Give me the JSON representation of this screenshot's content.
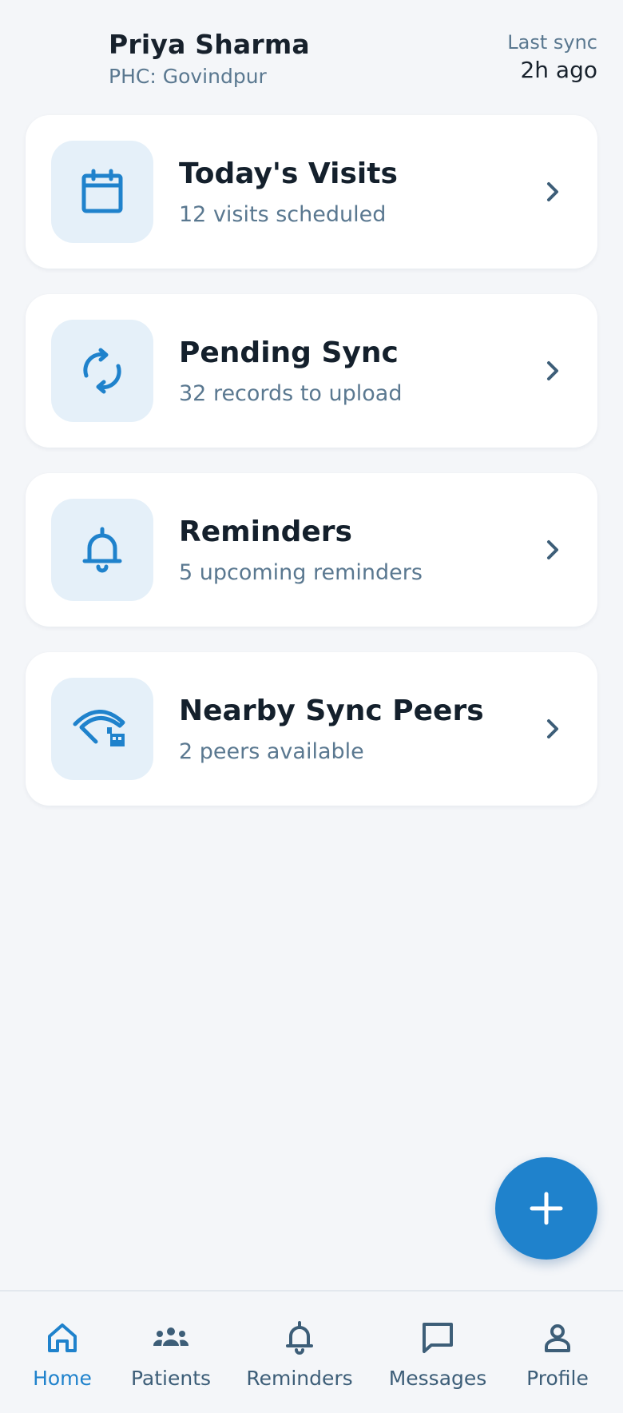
{
  "header": {
    "user_name": "Priya Sharma",
    "phc_label": "PHC: Govindpur",
    "last_sync_label": "Last sync",
    "last_sync_value": "2h ago"
  },
  "cards": [
    {
      "title": "Today's Visits",
      "subtitle": "12 visits scheduled",
      "icon": "calendar-icon"
    },
    {
      "title": "Pending Sync",
      "subtitle": "32 records to upload",
      "icon": "sync-icon"
    },
    {
      "title": "Reminders",
      "subtitle": "5 upcoming reminders",
      "icon": "bell-icon"
    },
    {
      "title": "Nearby Sync Peers",
      "subtitle": "2 peers available",
      "icon": "wifi-peers-icon"
    }
  ],
  "fab": {
    "icon": "plus-icon"
  },
  "bottom_nav": {
    "active": "Home",
    "items": [
      {
        "label": "Home",
        "icon": "home-icon"
      },
      {
        "label": "Patients",
        "icon": "people-icon"
      },
      {
        "label": "Reminders",
        "icon": "bell-icon"
      },
      {
        "label": "Messages",
        "icon": "message-icon"
      },
      {
        "label": "Profile",
        "icon": "person-icon"
      }
    ]
  },
  "colors": {
    "accent": "#1f82cc",
    "background": "#f4f6f9",
    "card": "#ffffff",
    "icon_tile": "#e5f0f9",
    "muted_text": "#5a7890",
    "nav_inactive": "#3d5e78"
  }
}
